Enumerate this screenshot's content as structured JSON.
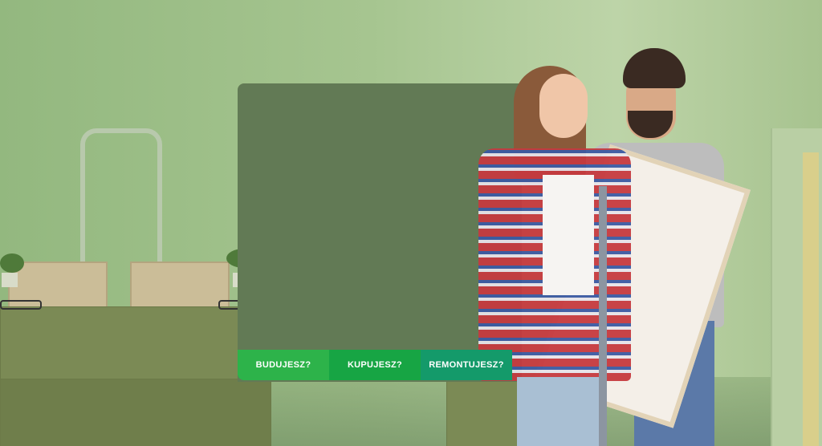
{
  "hero": {
    "tabs": [
      {
        "label": "BUDUJESZ?"
      },
      {
        "label": "KUPUJESZ?"
      },
      {
        "label": "REMONTUJESZ?"
      }
    ]
  },
  "colors": {
    "tab_1": "#2db34a",
    "tab_2": "#17a544",
    "tab_3": "#149a6a",
    "panel": "#627a55",
    "overlay": "#93b87f"
  }
}
